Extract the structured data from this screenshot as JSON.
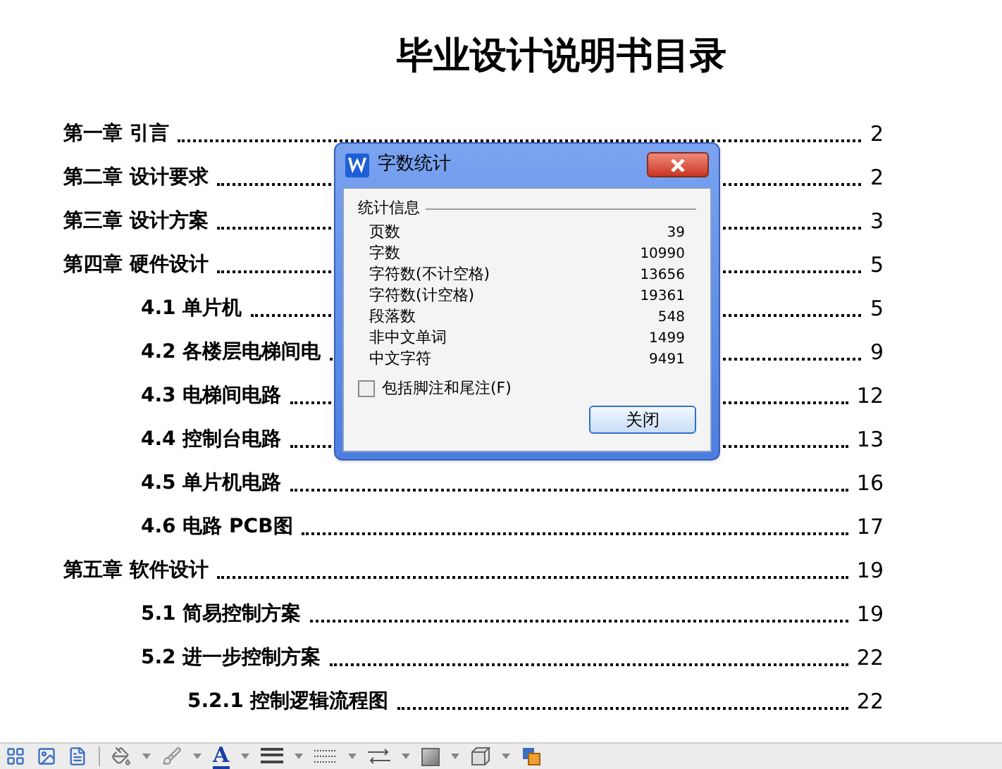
{
  "document": {
    "title": "毕业设计说明书目录",
    "toc": [
      {
        "label": "第一章  引言",
        "page": "2"
      },
      {
        "label": "第二章  设计要求",
        "page": "2"
      },
      {
        "label": "第三章  设计方案",
        "page": "3"
      },
      {
        "label": "第四章  硬件设计",
        "page": "5",
        "children": [
          {
            "label": "4.1 单片机",
            "page": "5"
          },
          {
            "label": "4.2 各楼层电梯间电",
            "page": "9"
          },
          {
            "label": "4.3 电梯间电路",
            "page": "12"
          },
          {
            "label": "4.4 控制台电路",
            "page": "13"
          },
          {
            "label": "4.5 单片机电路",
            "page": "16"
          },
          {
            "label": "4.6 电路 PCB图",
            "page": "17"
          }
        ]
      },
      {
        "label": "第五章  软件设计",
        "page": "19",
        "children": [
          {
            "label": "5.1 简易控制方案",
            "page": "19"
          },
          {
            "label": "5.2 进一步控制方案",
            "page": "22",
            "children": [
              {
                "label": "5.2.1 控制逻辑流程图",
                "page": "22"
              }
            ]
          }
        ]
      }
    ]
  },
  "dialog": {
    "title": "字数统计",
    "group_label": "统计信息",
    "stats": [
      {
        "label": "页数",
        "value": "39"
      },
      {
        "label": "字数",
        "value": "10990"
      },
      {
        "label": "字符数(不计空格)",
        "value": "13656"
      },
      {
        "label": "字符数(计空格)",
        "value": "19361"
      },
      {
        "label": "段落数",
        "value": "548"
      },
      {
        "label": "非中文单词",
        "value": "1499"
      },
      {
        "label": "中文字符",
        "value": "9491"
      }
    ],
    "checkbox": {
      "label": "包括脚注和尾注(F)",
      "checked": false
    },
    "button": "关闭"
  },
  "toolbar": {
    "font_color_label": "A"
  }
}
